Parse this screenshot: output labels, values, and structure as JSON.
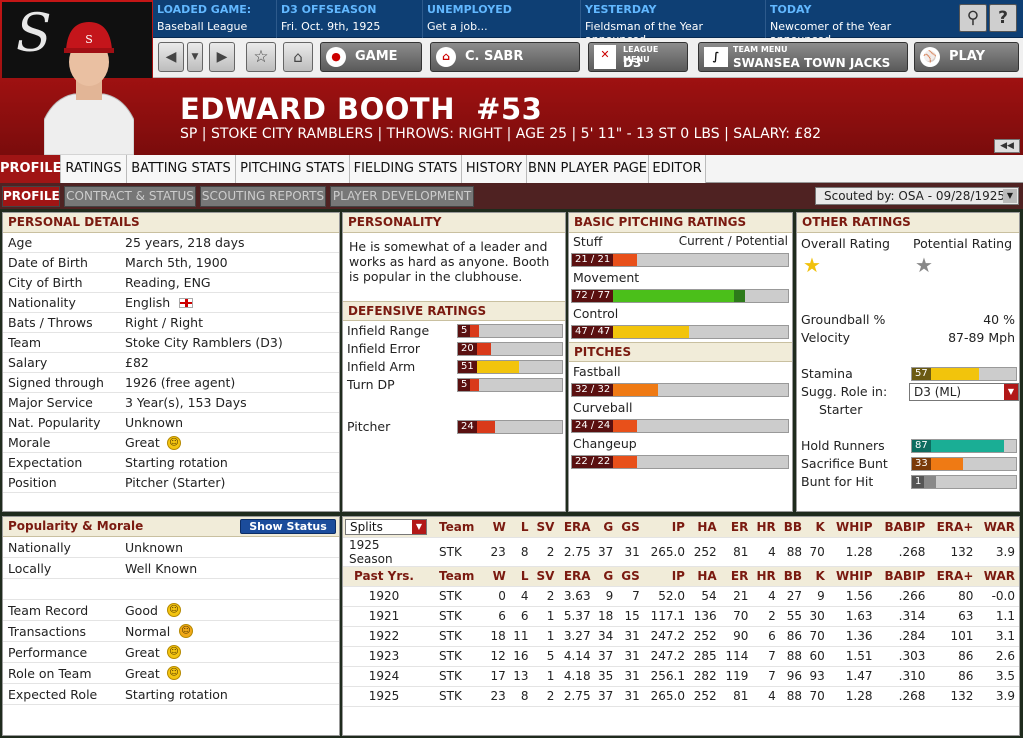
{
  "header": {
    "loaded_game": {
      "label": "LOADED GAME:",
      "value": "Baseball League"
    },
    "season": {
      "label": "D3 OFFSEASON",
      "value": "Fri. Oct. 9th, 1925"
    },
    "status": {
      "label": "UNEMPLOYED",
      "value": "Get a job..."
    },
    "yesterday": {
      "label": "YESTERDAY",
      "value": "Fieldsman of the Year announced"
    },
    "today": {
      "label": "TODAY",
      "value": "Newcomer of the Year announced"
    }
  },
  "nav": {
    "game": "GAME",
    "manager": "C. SABR",
    "league_menu_label": "LEAGUE MENU",
    "league_menu_value": "D3",
    "team_menu_label": "TEAM MENU",
    "team_menu_value": "SWANSEA TOWN JACKS",
    "play": "PLAY"
  },
  "player": {
    "name": "EDWARD BOOTH  #53",
    "info": "SP | STOKE CITY RAMBLERS | THROWS: RIGHT | AGE 25 | 5' 11\" - 13 ST 0 LBS | SALARY: £82"
  },
  "tabs": [
    "PROFILE",
    "RATINGS",
    "BATTING STATS",
    "PITCHING STATS",
    "FIELDING STATS",
    "HISTORY",
    "BNN PLAYER PAGE",
    "EDITOR"
  ],
  "subtabs": [
    "PROFILE",
    "CONTRACT & STATUS",
    "SCOUTING REPORTS",
    "PLAYER DEVELOPMENT"
  ],
  "scouted_by": "Scouted by: OSA - 09/28/1925",
  "personal": {
    "title": "PERSONAL DETAILS",
    "rows": [
      [
        "Age",
        "25 years, 218 days"
      ],
      [
        "Date of Birth",
        "March 5th, 1900"
      ],
      [
        "City of Birth",
        "Reading, ENG"
      ],
      [
        "Nationality",
        "English"
      ],
      [
        "Bats / Throws",
        "Right / Right"
      ],
      [
        "Team",
        "Stoke City Ramblers (D3)"
      ],
      [
        "Salary",
        "£82"
      ],
      [
        "Signed through",
        "1926 (free agent)"
      ],
      [
        "Major Service",
        "3 Year(s), 153 Days"
      ],
      [
        "Nat. Popularity",
        "Unknown"
      ],
      [
        "Morale",
        "Great"
      ],
      [
        "Expectation",
        "Starting rotation"
      ],
      [
        "Position",
        "Pitcher (Starter)"
      ]
    ]
  },
  "personality": {
    "title": "PERSONALITY",
    "text": "He is somewhat of a leader and works as hard as anyone. Booth is popular in the clubhouse."
  },
  "defensive": {
    "title": "DEFENSIVE RATINGS",
    "rows": [
      {
        "label": "Infield Range",
        "value": "5",
        "pct": 0.03,
        "color": "#d93a1a"
      },
      {
        "label": "Infield Error",
        "value": "20",
        "pct": 0.18,
        "color": "#d93a1a"
      },
      {
        "label": "Infield Arm",
        "value": "51",
        "pct": 0.5,
        "color": "#f2c40c"
      },
      {
        "label": "Turn DP",
        "value": "5",
        "pct": 0.03,
        "color": "#d93a1a"
      },
      {
        "label": "Pitcher",
        "value": "24",
        "pct": 0.22,
        "color": "#d93a1a"
      }
    ]
  },
  "pitching": {
    "title": "BASIC PITCHING RATINGS",
    "col_header": "Current / Potential",
    "ratings": [
      {
        "label": "Stuff",
        "value": "21 / 21",
        "pct": 0.3,
        "pot": 0.3,
        "color": "#e8501a"
      },
      {
        "label": "Movement",
        "value": "72 / 77",
        "pct": 0.75,
        "pot": 0.8,
        "color": "#4bbf1a"
      },
      {
        "label": "Control",
        "value": "47 / 47",
        "pct": 0.54,
        "pot": 0.54,
        "color": "#f2c40c"
      }
    ],
    "pitches_title": "PITCHES",
    "pitches": [
      {
        "label": "Fastball",
        "value": "32 / 32",
        "pct": 0.4,
        "pot": 0.4,
        "color": "#ef7a14"
      },
      {
        "label": "Curveball",
        "value": "24 / 24",
        "pct": 0.3,
        "pot": 0.3,
        "color": "#e8501a"
      },
      {
        "label": "Changeup",
        "value": "22 / 22",
        "pct": 0.3,
        "pot": 0.3,
        "color": "#e8501a"
      }
    ]
  },
  "other": {
    "title": "OTHER RATINGS",
    "overall_label": "Overall Rating",
    "potential_label": "Potential Rating",
    "groundball_label": "Groundball %",
    "groundball": "40 %",
    "velocity_label": "Velocity",
    "velocity": "87-89 Mph",
    "stamina_label": "Stamina",
    "stamina": "57",
    "stamina_pct": 0.55,
    "role_label": "Sugg. Role in:",
    "role_select": "D3 (ML)",
    "role_value": "Starter",
    "hold_label": "Hold Runners",
    "hold": "87",
    "hold_pct": 0.85,
    "sacbunt_label": "Sacrifice Bunt",
    "sacbunt": "33",
    "sacbunt_pct": 0.35,
    "bunthit_label": "Bunt for Hit",
    "bunthit": "1",
    "bunthit_pct": 0.02
  },
  "popularity": {
    "title": "Popularity & Morale",
    "button": "Show Status",
    "rows": [
      [
        "Nationally",
        "Unknown",
        false
      ],
      [
        "Locally",
        "Well Known",
        false
      ],
      [
        "",
        "",
        false
      ],
      [
        "Team Record",
        "Good",
        true
      ],
      [
        "Transactions",
        "Normal",
        true
      ],
      [
        "Performance",
        "Great",
        true
      ],
      [
        "Role on Team",
        "Great",
        true
      ],
      [
        "Expected Role",
        "Starting rotation",
        false
      ]
    ]
  },
  "stats": {
    "splits_label": "Splits",
    "columns": [
      "Team",
      "W",
      "L",
      "SV",
      "ERA",
      "G",
      "GS",
      "IP",
      "HA",
      "ER",
      "HR",
      "BB",
      "K",
      "WHIP",
      "BABIP",
      "ERA+",
      "WAR"
    ],
    "current": [
      "1925 Season",
      "STK",
      "23",
      "8",
      "2",
      "2.75",
      "37",
      "31",
      "265.0",
      "252",
      "81",
      "4",
      "88",
      "70",
      "1.28",
      ".268",
      "132",
      "3.9"
    ],
    "past_label": "Past Yrs.",
    "past": [
      [
        "1920",
        "STK",
        "0",
        "4",
        "2",
        "3.63",
        "9",
        "7",
        "52.0",
        "54",
        "21",
        "4",
        "27",
        "9",
        "1.56",
        ".266",
        "80",
        "-0.0"
      ],
      [
        "1921",
        "STK",
        "6",
        "6",
        "1",
        "5.37",
        "18",
        "15",
        "117.1",
        "136",
        "70",
        "2",
        "55",
        "30",
        "1.63",
        ".314",
        "63",
        "1.1"
      ],
      [
        "1922",
        "STK",
        "18",
        "11",
        "1",
        "3.27",
        "34",
        "31",
        "247.2",
        "252",
        "90",
        "6",
        "86",
        "70",
        "1.36",
        ".284",
        "101",
        "3.1"
      ],
      [
        "1923",
        "STK",
        "12",
        "16",
        "5",
        "4.14",
        "37",
        "31",
        "247.2",
        "285",
        "114",
        "7",
        "88",
        "60",
        "1.51",
        ".303",
        "86",
        "2.6"
      ],
      [
        "1924",
        "STK",
        "17",
        "13",
        "1",
        "4.18",
        "35",
        "31",
        "256.1",
        "282",
        "119",
        "7",
        "96",
        "93",
        "1.47",
        ".310",
        "86",
        "3.5"
      ],
      [
        "1925",
        "STK",
        "23",
        "8",
        "2",
        "2.75",
        "37",
        "31",
        "265.0",
        "252",
        "81",
        "4",
        "88",
        "70",
        "1.28",
        ".268",
        "132",
        "3.9"
      ]
    ]
  }
}
